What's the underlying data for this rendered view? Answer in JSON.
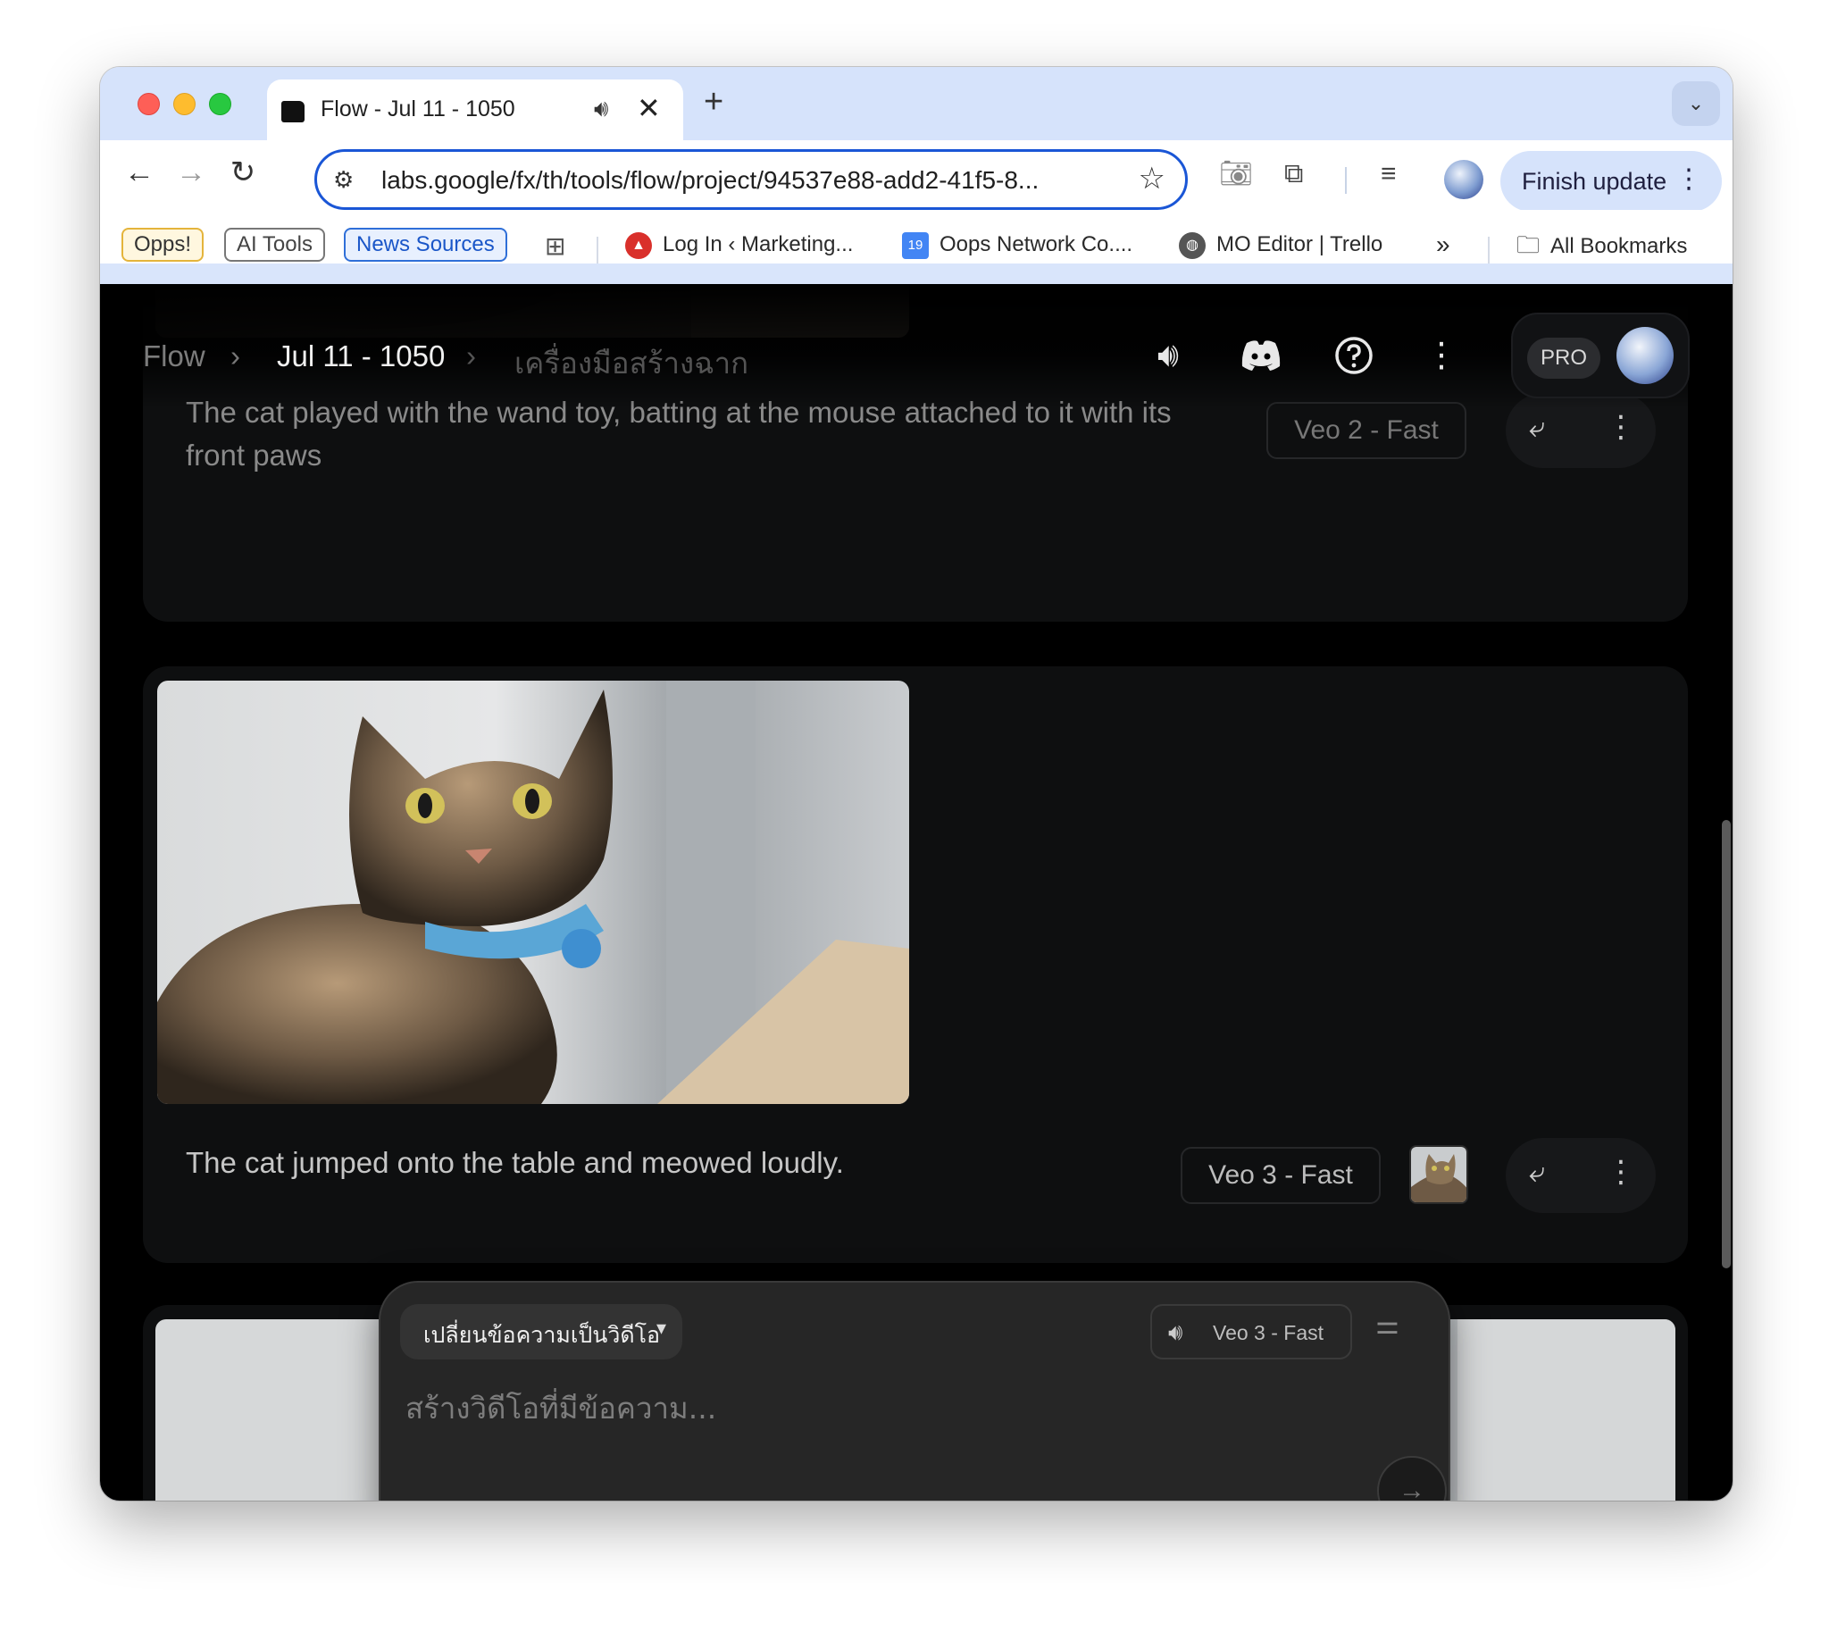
{
  "browser": {
    "tab": {
      "title": "Flow - Jul 11 - 1050"
    },
    "url": "labs.google/fx/th/tools/flow/project/94537e88-add2-41f5-8...",
    "finish_update_label": "Finish update",
    "bookmarks": [
      {
        "label": "Opps!"
      },
      {
        "label": "AI Tools"
      },
      {
        "label": "News Sources"
      },
      {
        "label": "Log In ‹ Marketing..."
      },
      {
        "label": "Oops Network Co...."
      },
      {
        "label": "MO Editor | Trello"
      },
      {
        "label": "All Bookmarks"
      }
    ],
    "calendar_badge": "19"
  },
  "app": {
    "breadcrumb": {
      "root": "Flow",
      "project": "Jul 11 - 1050",
      "tool": "เครื่องมือสร้างฉาก"
    },
    "plan_badge": "PRO",
    "clips": [
      {
        "prompt": "The cat played with the wand toy, batting at the mouse attached to it with its front paws",
        "model": "Veo 2 - Fast"
      },
      {
        "prompt": "The cat jumped onto the table and meowed loudly.",
        "model": "Veo 3 - Fast"
      }
    ],
    "composer": {
      "mode": "เปลี่ยนข้อความเป็นวิดีโอ",
      "model": "Veo 3 - Fast",
      "placeholder": "สร้างวิดีโอที่มีข้อความ..."
    }
  },
  "colors": {
    "accent": "#1a56d6",
    "background": "#000000",
    "card": "#0e0f10"
  },
  "icons": [
    "back-arrow-icon",
    "forward-arrow-icon",
    "reload-icon",
    "site-settings-icon",
    "star-icon",
    "camera-icon",
    "extensions-icon",
    "media-queue-icon",
    "volume-icon",
    "discord-icon",
    "help-icon",
    "more-vert-icon",
    "wrap-text-icon",
    "tune-icon",
    "send-arrow-icon",
    "close-icon",
    "plus-icon",
    "chevron-down-icon",
    "folder-icon",
    "grid-icon"
  ]
}
